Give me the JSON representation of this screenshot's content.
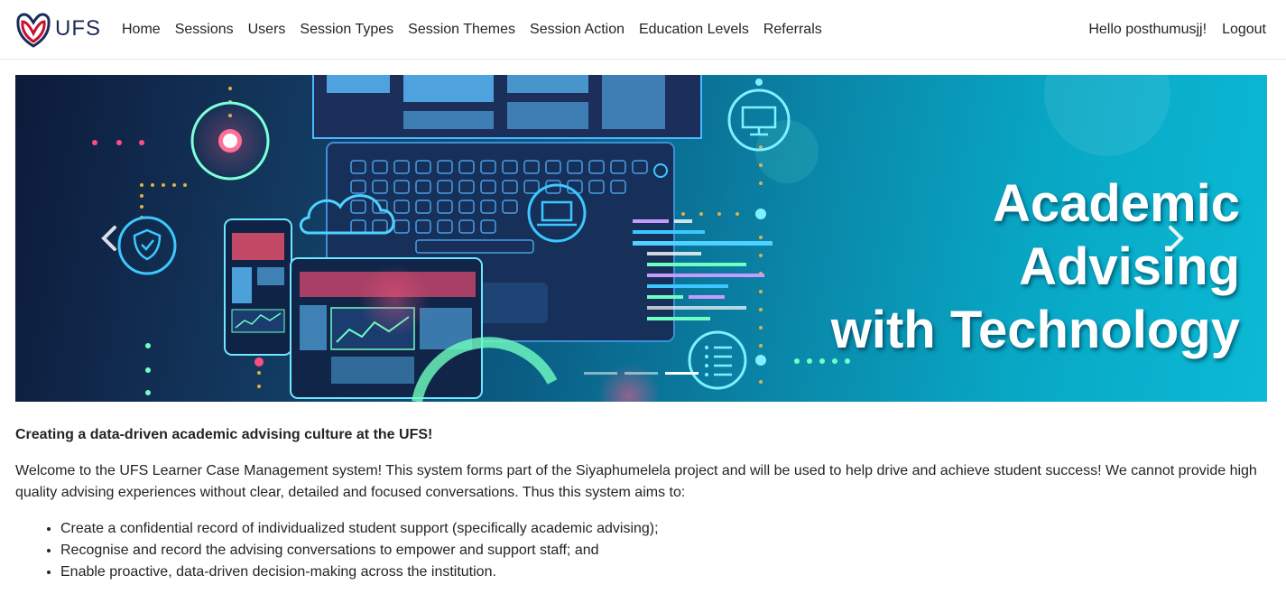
{
  "brand": {
    "name": "UFS",
    "logo_icon": "ufs-shield-logo",
    "accent": "#c8102e",
    "navy": "#1d2b5c"
  },
  "nav": {
    "items": [
      {
        "label": "Home"
      },
      {
        "label": "Sessions"
      },
      {
        "label": "Users"
      },
      {
        "label": "Session Types"
      },
      {
        "label": "Session Themes"
      },
      {
        "label": "Session Action"
      },
      {
        "label": "Education Levels"
      },
      {
        "label": "Referrals"
      }
    ],
    "greeting": "Hello posthumusjj!",
    "logout_label": "Logout"
  },
  "carousel": {
    "slide_title_line1": "Academic Advising",
    "slide_title_line2": "with Technology",
    "prev_icon": "chevron-left-icon",
    "next_icon": "chevron-right-icon",
    "slide_count": 3,
    "active_slide": 3
  },
  "content": {
    "heading": "Creating a data-driven academic advising culture at the UFS!",
    "intro": "Welcome to the UFS Learner Case Management system! This system forms part of the Siyaphumelela project and will be used to help drive and achieve student success! We cannot provide high quality advising experiences without clear, detailed and focused conversations. Thus this system aims to:",
    "aims": [
      "Create a confidential record of individualized student support (specifically academic advising);",
      "Recognise and record the advising conversations to empower and support staff; and",
      "Enable proactive, data-driven decision-making across the institution."
    ]
  }
}
